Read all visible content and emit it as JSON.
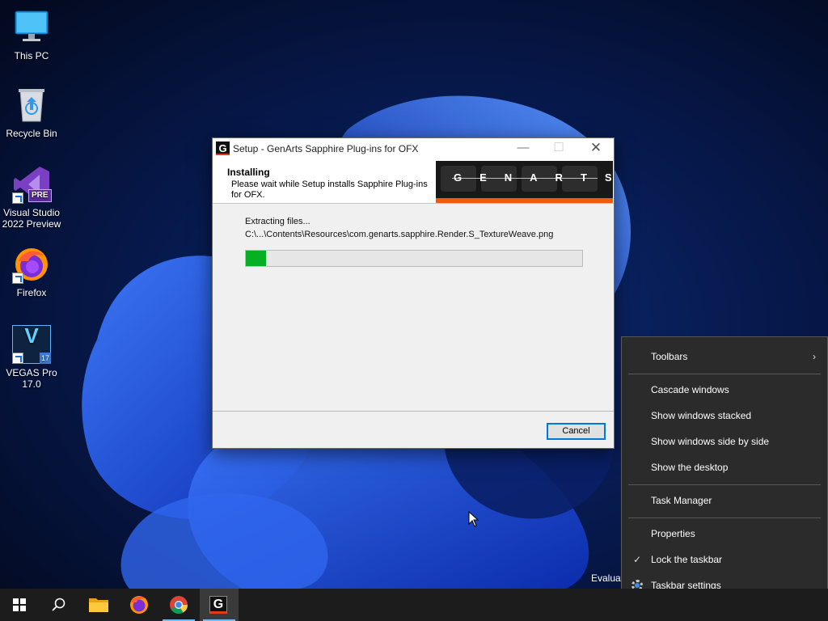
{
  "desktop": {
    "icons": [
      {
        "label": "This PC"
      },
      {
        "label": "Recycle Bin"
      },
      {
        "label": "Visual Studio 2022 Preview",
        "badge": "PRE"
      },
      {
        "label": "Firefox"
      },
      {
        "label": "VEGAS Pro 17.0",
        "letter": "V",
        "badge": "17"
      }
    ]
  },
  "setup": {
    "title": "Setup - GenArts Sapphire Plug-ins for OFX",
    "app_icon_letter": "G",
    "header_title": "Installing",
    "header_desc": "Please wait while Setup installs Sapphire Plug-ins for OFX.",
    "banner_letters": "GENARTS",
    "status": "Extracting files...",
    "path": "C:\\...\\Contents\\Resources\\com.genarts.sapphire.Render.S_TextureWeave.png",
    "progress": 0.06,
    "cancel_label": "Cancel",
    "controls": {
      "minimize": "—",
      "maximize": "☐",
      "close": "✕"
    }
  },
  "context_menu": {
    "items": [
      {
        "label": "Toolbars",
        "submenu": true
      },
      {
        "label": "Cascade windows"
      },
      {
        "label": "Show windows stacked"
      },
      {
        "label": "Show windows side by side"
      },
      {
        "label": "Show the desktop"
      },
      {
        "label": "Task Manager"
      },
      {
        "label": "Properties"
      },
      {
        "label": "Lock the taskbar",
        "checked": true
      },
      {
        "label": "Taskbar settings",
        "icon": "gear-icon"
      }
    ],
    "arrow": "›",
    "check": "✓"
  },
  "watermark": "Evaluat",
  "taskbar": {
    "items": [
      "windows-start-icon",
      "search-icon",
      "file-explorer-icon",
      "firefox-icon",
      "chrome-icon",
      "genarts-setup-icon"
    ],
    "active": "genarts-setup-icon",
    "setup_letter": "G"
  },
  "colors": {
    "progress": "#06b025",
    "accent": "#0078d7",
    "genarts_orange": "#f05a0a",
    "taskbar": "#1c1c1c",
    "menu_bg": "#2b2b2b"
  }
}
